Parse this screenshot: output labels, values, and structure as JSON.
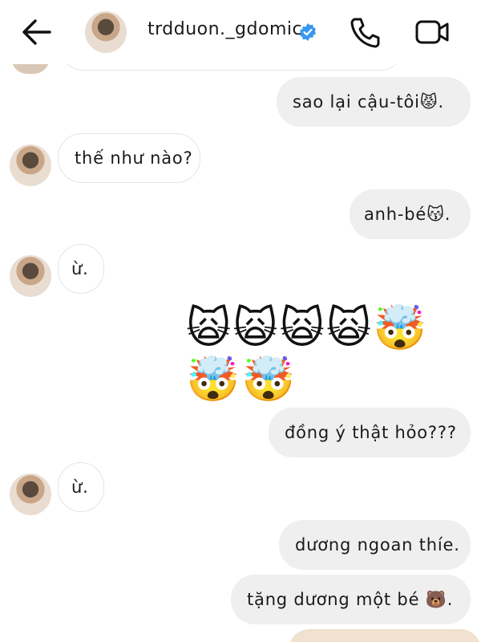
{
  "header": {
    "username": "trdduon._gdomic"
  },
  "messages": {
    "m1": "sao lại cậu-tôi😾.",
    "m2": "thế như nào?",
    "m3": "anh-bé😽.",
    "m4": "ừ.",
    "emoji_row_1": "🙀🙀🙀🙀🤯",
    "emoji_row_2": "🤯🤯",
    "m5": "đồng ý thật hỏo???",
    "m6": "ừ.",
    "m7": "dương ngoan thíe.",
    "m8": "tặng dương một bé 🐻."
  },
  "colors": {
    "outgoing_bubble": "#efefef",
    "verified_badge": "#3897f0"
  },
  "icons": [
    "back-arrow-icon",
    "verified-badge-icon",
    "phone-icon",
    "video-camera-icon"
  ]
}
